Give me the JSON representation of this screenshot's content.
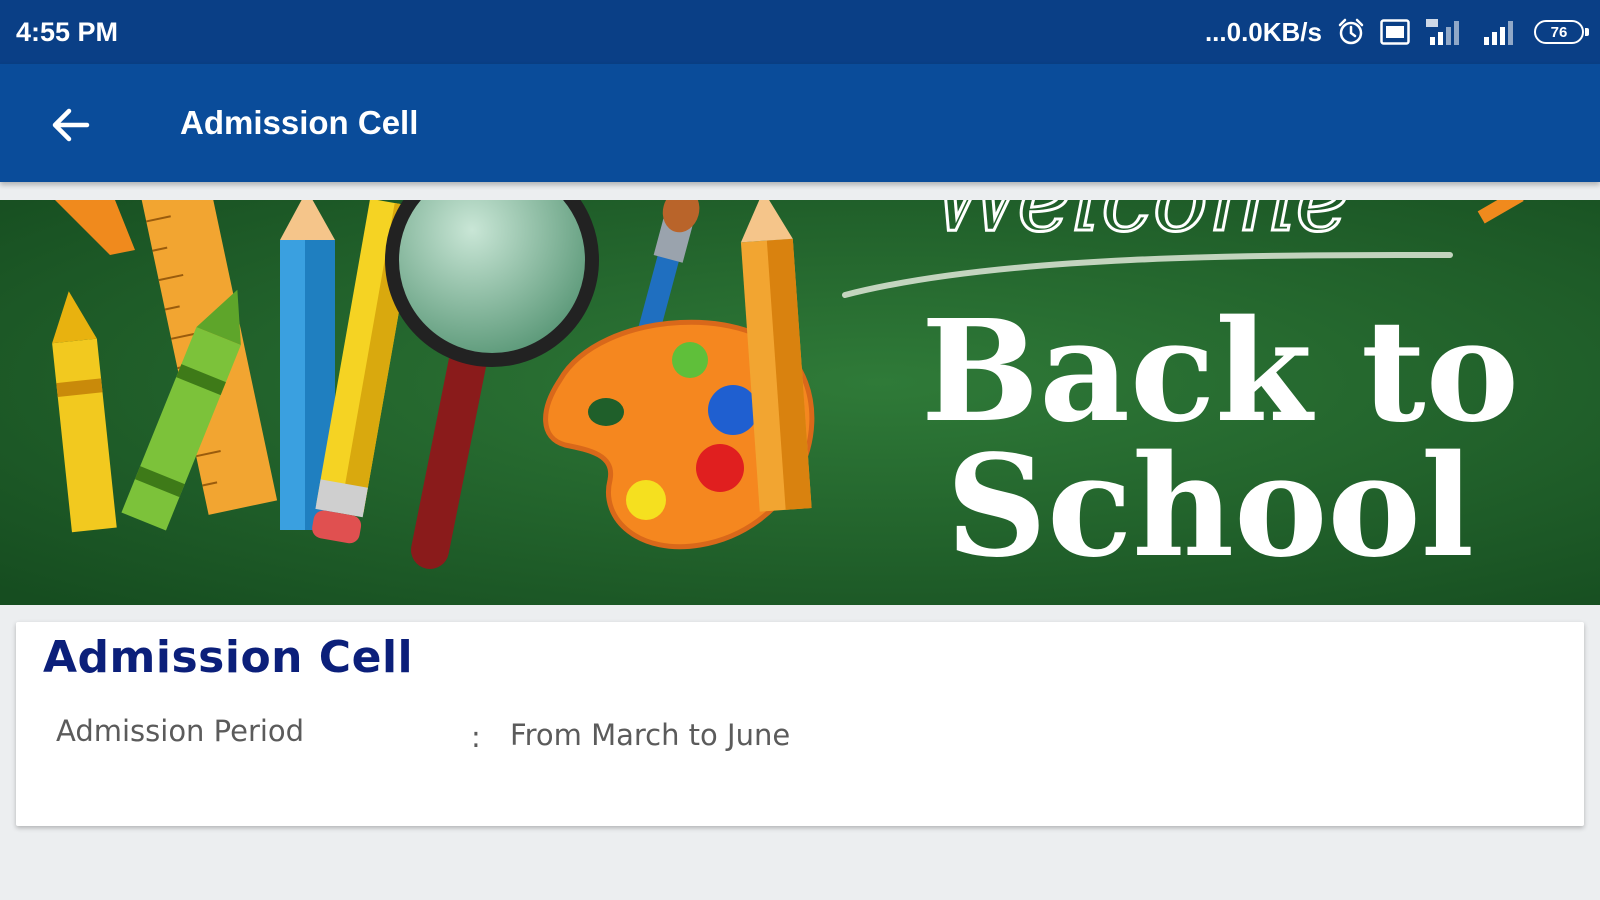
{
  "status_bar": {
    "time": "4:55 PM",
    "network_speed": "...0.0KB/s",
    "battery_level": "76",
    "icons": [
      "alarm-icon",
      "hd-voice-icon",
      "signal-4g-icon",
      "signal-icon",
      "battery-icon"
    ]
  },
  "app_bar": {
    "title": "Admission Cell",
    "back_icon": "arrow-left-icon"
  },
  "banner": {
    "welcome_text": "Welcome",
    "headline_line1": "Back to",
    "headline_line2": "School",
    "background_color": "#1f5f2a"
  },
  "card": {
    "title": "Admission Cell",
    "rows": [
      {
        "label": "Admission Period",
        "separator": ":",
        "value": "From March to June"
      }
    ]
  },
  "colors": {
    "status_bar": "#0a3f86",
    "app_bar": "#0a4c9a",
    "card_title": "#0b1f7a",
    "page_background": "#eceef0"
  }
}
